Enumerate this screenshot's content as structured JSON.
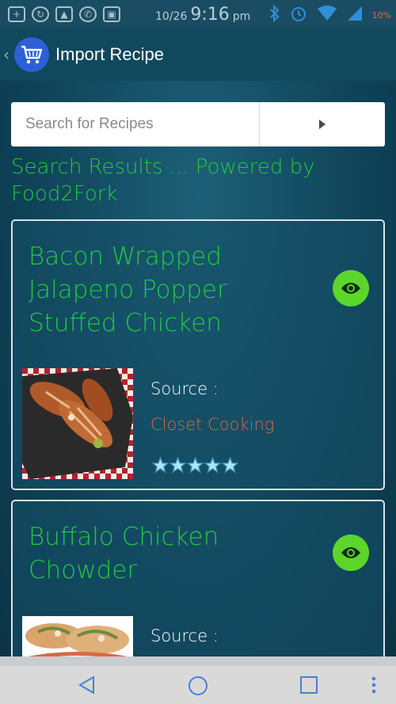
{
  "status_bar": {
    "date": "10/26",
    "time": "9:16",
    "ampm": "pm",
    "battery": "10%"
  },
  "app_bar": {
    "back_glyph": "‹",
    "title": "Import Recipe",
    "logo_icon": "shopping-cart-icon"
  },
  "search": {
    "placeholder": "Search for Recipes",
    "value": "",
    "go_icon": "play-arrow-icon"
  },
  "results_heading": "Search Results ... Powered by Food2Fork",
  "results": [
    {
      "title": "Bacon Wrapped Jalapeno Popper Stuffed Chicken",
      "source_label": "Source :",
      "source_name": "Closet Cooking",
      "rating": 5,
      "view_icon": "eye-icon"
    },
    {
      "title": "Buffalo Chicken Chowder",
      "source_label": "Source :",
      "source_name": "",
      "view_icon": "eye-icon"
    }
  ],
  "nav_bar": {
    "back_icon": "triangle-back-icon",
    "home_icon": "circle-home-icon",
    "recents_icon": "square-recents-icon",
    "menu_icon": "overflow-menu-icon"
  },
  "colors": {
    "accent_green": "#22c93f",
    "source_orange": "#d46a42",
    "view_button": "#5cd62a",
    "background": "#0f4258"
  }
}
